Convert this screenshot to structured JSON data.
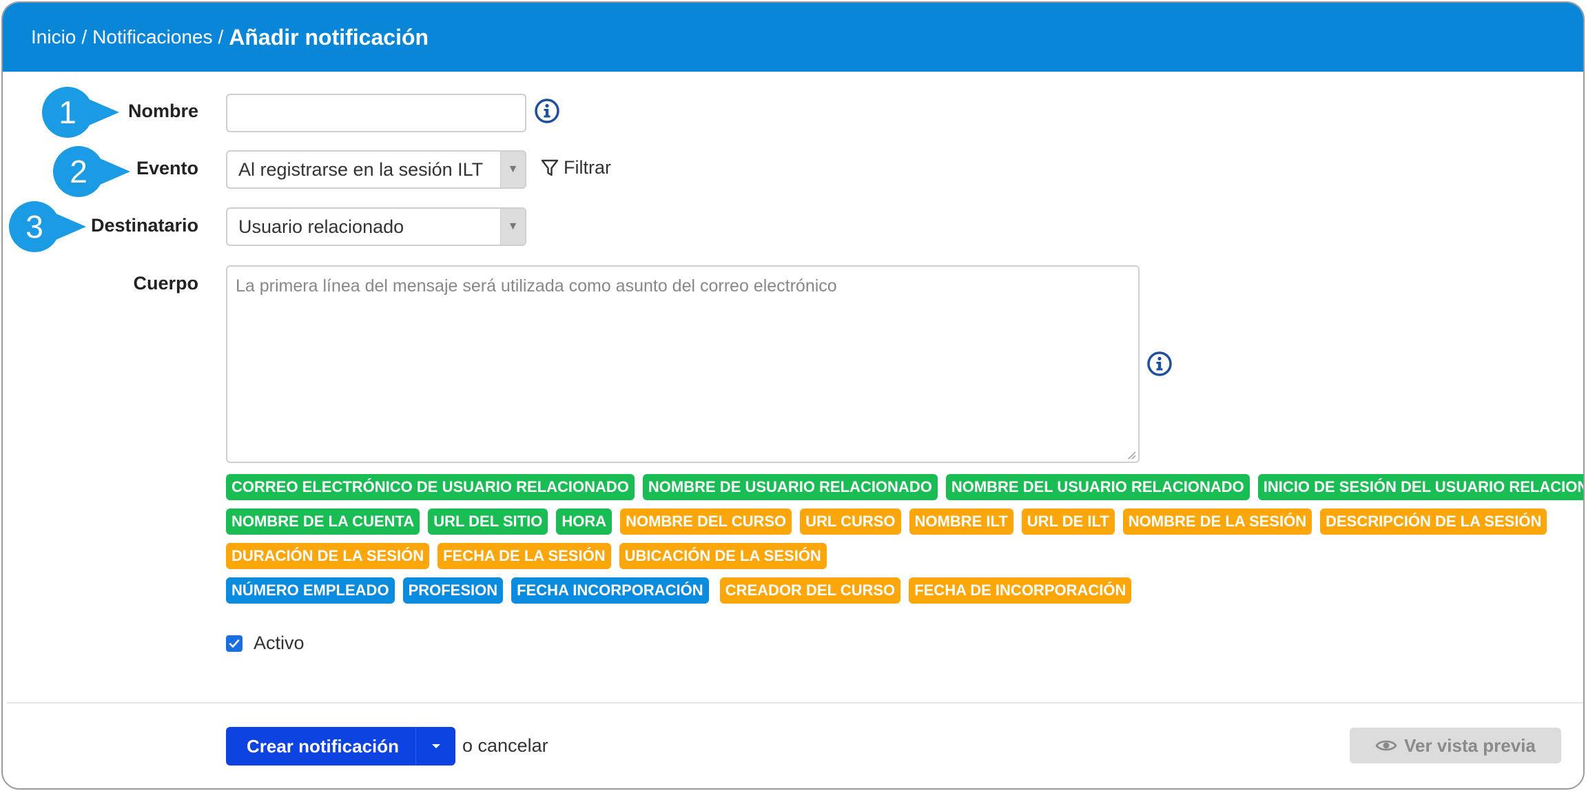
{
  "breadcrumb": {
    "items": [
      "Inicio",
      "Notificaciones"
    ],
    "separator": "/",
    "current": "Añadir notificación"
  },
  "form": {
    "name": {
      "label": "Nombre",
      "value": "",
      "callout": "1"
    },
    "event": {
      "label": "Evento",
      "value": "Al registrarse en la sesión ILT",
      "callout": "2",
      "filter_label": "Filtrar"
    },
    "recipient": {
      "label": "Destinatario",
      "value": "Usuario relacionado",
      "callout": "3"
    },
    "body": {
      "label": "Cuerpo",
      "placeholder": "La primera línea del mensaje será utilizada como asunto del correo electrónico"
    },
    "active": {
      "label": "Activo",
      "checked": true
    }
  },
  "tags": [
    [
      {
        "text": "CORREO ELECTRÓNICO DE USUARIO RELACIONADO",
        "color": "green"
      },
      {
        "text": "NOMBRE DE USUARIO RELACIONADO",
        "color": "green"
      },
      {
        "text": "NOMBRE DEL USUARIO RELACIONADO",
        "color": "green"
      },
      {
        "text": "INICIO DE SESIÓN DEL USUARIO RELACIONADO",
        "color": "green"
      }
    ],
    [
      {
        "text": "NOMBRE DE LA CUENTA",
        "color": "green"
      },
      {
        "text": "URL DEL SITIO",
        "color": "green"
      },
      {
        "text": "HORA",
        "color": "green"
      },
      {
        "text": "NOMBRE DEL CURSO",
        "color": "orange"
      },
      {
        "text": "URL CURSO",
        "color": "orange"
      },
      {
        "text": "NOMBRE ILT",
        "color": "orange"
      },
      {
        "text": "URL DE ILT",
        "color": "orange"
      },
      {
        "text": "NOMBRE DE LA SESIÓN",
        "color": "orange"
      },
      {
        "text": "DESCRIPCIÓN DE LA SESIÓN",
        "color": "orange"
      }
    ],
    [
      {
        "text": "DURACIÓN DE LA SESIÓN",
        "color": "orange"
      },
      {
        "text": "FECHA DE LA SESIÓN",
        "color": "orange"
      },
      {
        "text": "UBICACIÓN DE LA SESIÓN",
        "color": "orange"
      }
    ],
    [
      {
        "text": "NÚMERO EMPLEADO",
        "color": "blue"
      },
      {
        "text": "PROFESION",
        "color": "blue"
      },
      {
        "text": "FECHA INCORPORACIÓN",
        "color": "blue"
      },
      {
        "text": "CREADOR DEL CURSO",
        "color": "orange"
      },
      {
        "text": "FECHA DE INCORPORACIÓN",
        "color": "orange"
      }
    ]
  ],
  "footer": {
    "create_label": "Crear notificación",
    "cancel_label": "o cancelar",
    "preview_label": "Ver vista previa"
  },
  "colors": {
    "header": "#0a86d8",
    "callout": "#1a9be3",
    "tag_green": "#19bd54",
    "tag_orange": "#fba70c",
    "tag_blue": "#0b8bdd",
    "primary_button": "#0d43e0",
    "info_icon": "#1d4f9c"
  },
  "icons": [
    "info-icon",
    "filter-icon",
    "dropdown-arrow-icon",
    "checkmark-icon",
    "caret-down-icon",
    "eye-icon"
  ]
}
